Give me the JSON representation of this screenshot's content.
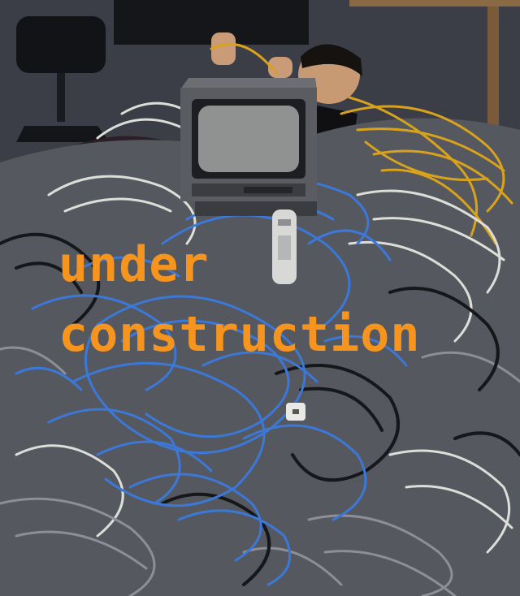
{
  "overlay": {
    "line1": "under",
    "line2": "construction",
    "text_color": "#f7941d"
  },
  "cable_colors": [
    "#3b78d8",
    "#d9a21c",
    "#d8d8d2",
    "#1b1c1f",
    "#8c8f96"
  ]
}
